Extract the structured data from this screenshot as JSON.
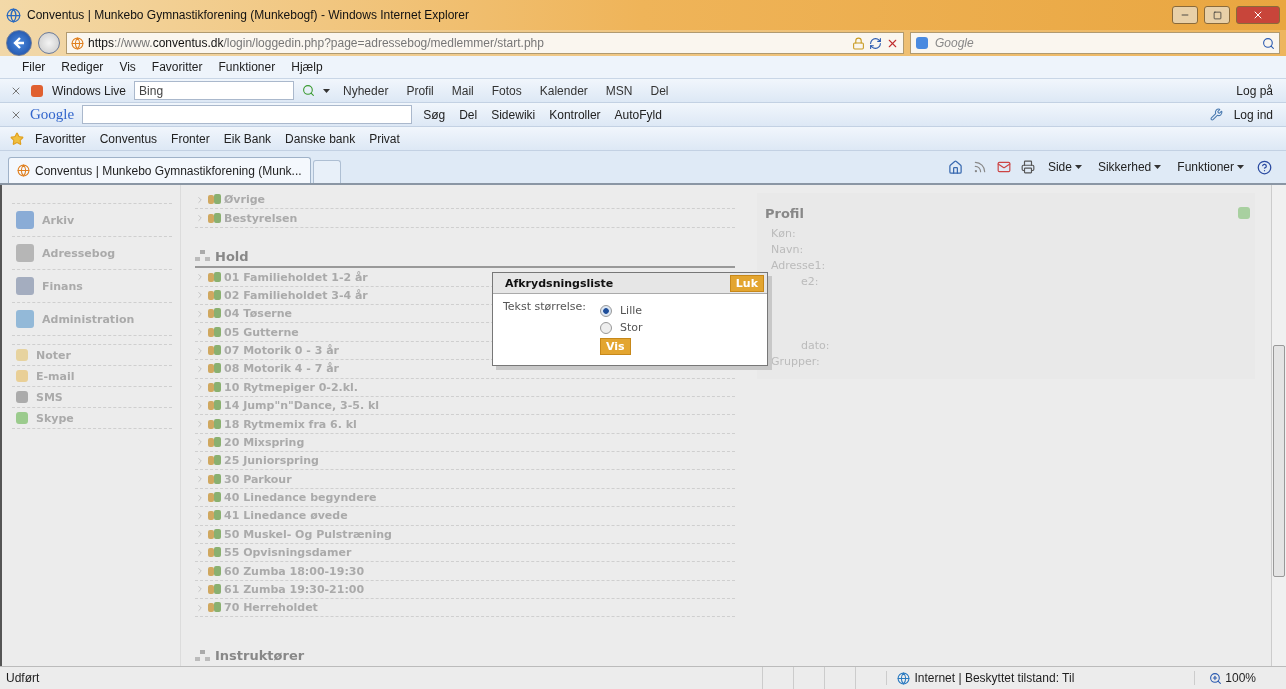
{
  "window": {
    "title": "Conventus | Munkebo Gymnastikforening (Munkebogf) - Windows Internet Explorer"
  },
  "address_bar": {
    "url_prefix": "https://www.",
    "url_domain": "conventus.dk",
    "url_path": "/login/loggedin.php?page=adressebog/medlemmer/start.php",
    "search_placeholder": "Google"
  },
  "menu": [
    "Filer",
    "Rediger",
    "Vis",
    "Favoritter",
    "Funktioner",
    "Hjælp"
  ],
  "live_toolbar": {
    "label": "Windows Live",
    "search_value": "Bing",
    "links": [
      "Nyheder",
      "Profil",
      "Mail",
      "Fotos",
      "Kalender",
      "MSN",
      "Del"
    ],
    "login": "Log på"
  },
  "google_toolbar": {
    "logo": "Google",
    "buttons": [
      "Søg",
      "Del",
      "Sidewiki",
      "Kontroller",
      "AutoFyld"
    ],
    "login": "Log ind"
  },
  "favorites_bar": {
    "label": "Favoritter",
    "items": [
      "Conventus",
      "Fronter",
      "Eik Bank",
      "Danske bank",
      "Privat"
    ]
  },
  "tabs": [
    {
      "label": "Conventus | Munkebo Gymnastikforening (Munk...",
      "selected": true
    }
  ],
  "command_bar": [
    "Side",
    "Sikkerhed",
    "Funktioner"
  ],
  "sidebar": {
    "groups": [
      {
        "items": [
          "Arkiv",
          "Adressebog",
          "Finans",
          "Administration"
        ]
      },
      {
        "items": [
          "Noter",
          "E-mail",
          "SMS",
          "Skype"
        ]
      }
    ]
  },
  "top_groups": [
    "Øvrige",
    "Bestyrelsen"
  ],
  "hold": {
    "heading": "Hold",
    "items": [
      "01 Familieholdet 1-2 år",
      "02 Familieholdet 3-4 år",
      "04 Tøserne",
      "05 Gutterne",
      "07 Motorik 0 - 3 år",
      "08 Motorik 4 - 7 år",
      "10 Rytmepiger 0-2.kl.",
      "14 Jump\"n\"Dance, 3-5. kl",
      "18 Rytmemix fra 6. kl",
      "20 Mixspring",
      "25 Juniorspring",
      "30 Parkour",
      "40 Linedance begyndere",
      "41 Linedance øvede",
      "50 Muskel- Og Pulstræning",
      "55 Opvisningsdamer",
      "60 Zumba 18:00-19:30",
      "61 Zumba 19:30-21:00",
      "70 Herreholdet"
    ]
  },
  "instructors_heading": "Instruktører",
  "profile": {
    "title": "Profil",
    "fields": [
      {
        "label": "Køn:",
        "kind": "full"
      },
      {
        "label": "Navn:",
        "kind": "full"
      },
      {
        "label": "Adresse1:",
        "kind": "full"
      },
      {
        "label": "e2:",
        "kind": "partial"
      },
      {
        "kind": "gap"
      },
      {
        "kind": "gap"
      },
      {
        "kind": "gap"
      },
      {
        "label": "dato:",
        "kind": "partial"
      },
      {
        "label": "Grupper:",
        "kind": "full"
      }
    ]
  },
  "dialog": {
    "title": "Afkrydsningsliste",
    "close": "Luk",
    "label": "Tekst størrelse:",
    "options": [
      {
        "label": "Lille",
        "selected": true
      },
      {
        "label": "Stor",
        "selected": false
      }
    ],
    "submit": "Vis"
  },
  "status_bar": {
    "text": "Udført",
    "zone": "Internet | Beskyttet tilstand: Til",
    "zoom": "100%"
  }
}
